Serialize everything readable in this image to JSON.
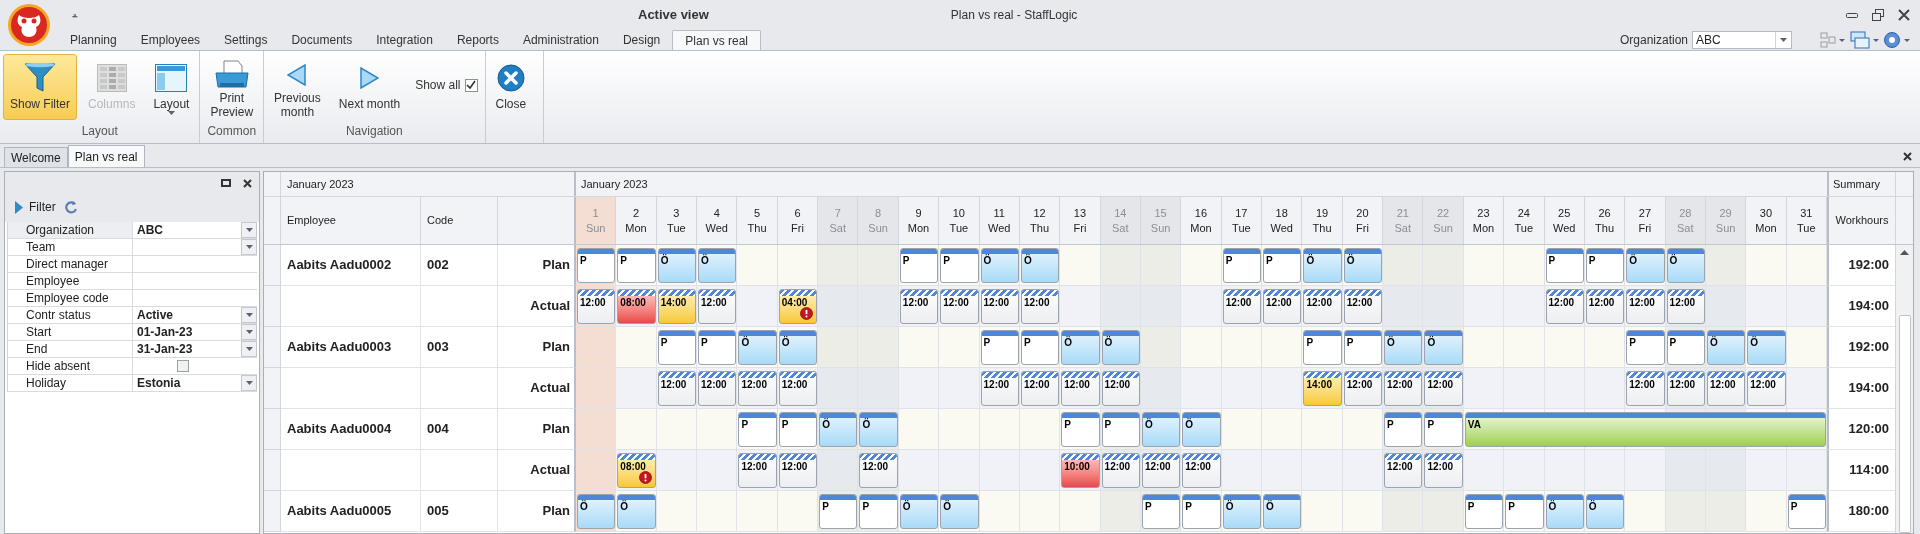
{
  "app": {
    "title": "Active view",
    "window_title": "Plan vs real - StaffLogic",
    "quick_access": "⩡"
  },
  "menu_tabs": [
    {
      "label": "Planning",
      "selected": false
    },
    {
      "label": "Employees",
      "selected": false
    },
    {
      "label": "Settings",
      "selected": false
    },
    {
      "label": "Documents",
      "selected": false
    },
    {
      "label": "Integration",
      "selected": false
    },
    {
      "label": "Reports",
      "selected": false
    },
    {
      "label": "Administration",
      "selected": false
    },
    {
      "label": "Design",
      "selected": false
    },
    {
      "label": "Plan vs real",
      "selected": true
    }
  ],
  "organization": {
    "label": "Organization",
    "value": "ABC"
  },
  "ribbon": [
    {
      "label": "Layout",
      "items": [
        {
          "kind": "filter",
          "label": "Show Filter",
          "pressed": true,
          "disabled": false
        },
        {
          "kind": "columns",
          "label": "Columns",
          "pressed": false,
          "disabled": true
        },
        {
          "kind": "layout",
          "label": "Layout",
          "pressed": false,
          "disabled": false
        }
      ]
    },
    {
      "label": "Common",
      "items": [
        {
          "kind": "print",
          "label": "Print Preview",
          "pressed": false,
          "disabled": false
        }
      ]
    },
    {
      "label": "Navigation",
      "items": [
        {
          "kind": "previous",
          "label": "Previous month",
          "pressed": false,
          "disabled": false
        },
        {
          "kind": "next",
          "label": "Next month",
          "pressed": false,
          "disabled": false
        },
        {
          "kind": "checkbox",
          "label": "Show all",
          "checked": true
        }
      ]
    },
    {
      "items": [
        {
          "kind": "close",
          "label": "Close",
          "pressed": false,
          "disabled": false
        }
      ]
    }
  ],
  "doc_tabs": [
    {
      "label": "Welcome",
      "selected": false
    },
    {
      "label": "Plan vs real",
      "selected": true
    }
  ],
  "filter_panel": {
    "title": "Filter",
    "rows": [
      {
        "label": "Organization",
        "kind": "combo",
        "value": "ABC",
        "selected": true
      },
      {
        "label": "Team",
        "kind": "combo",
        "selected": false
      },
      {
        "label": "Direct manager",
        "kind": "text",
        "selected": false
      },
      {
        "label": "Employee",
        "kind": "text",
        "selected": false
      },
      {
        "label": "Employee code",
        "kind": "text",
        "selected": false
      },
      {
        "label": "Contr status",
        "kind": "combo",
        "value": "Active",
        "selected": false
      },
      {
        "label": "Start",
        "kind": "combo",
        "value": "01-Jan-23",
        "selected": false
      },
      {
        "label": "End",
        "kind": "combo",
        "value": "31-Jan-23",
        "selected": false
      },
      {
        "label": "Hide absent",
        "kind": "checkbox",
        "checked": false,
        "selected": false
      },
      {
        "label": "Holiday",
        "kind": "combo",
        "value": "Estonia",
        "selected": false
      }
    ]
  },
  "grid": {
    "period_left": "January 2023",
    "period_days": "January 2023",
    "summary_title": "Summary",
    "columns": [
      "Employee",
      "Code"
    ],
    "summary_column": "Workhours",
    "days": [
      {
        "day": "1",
        "name": "Sun",
        "kind": "holiday"
      },
      {
        "day": "2",
        "name": "Mon",
        "kind": "workday"
      },
      {
        "day": "3",
        "name": "Tue",
        "kind": "workday"
      },
      {
        "day": "4",
        "name": "Wed",
        "kind": "workday"
      },
      {
        "day": "5",
        "name": "Thu",
        "kind": "workday"
      },
      {
        "day": "6",
        "name": "Fri",
        "kind": "workday"
      },
      {
        "day": "7",
        "name": "Sat",
        "kind": "weekend"
      },
      {
        "day": "8",
        "name": "Sun",
        "kind": "weekend"
      },
      {
        "day": "9",
        "name": "Mon",
        "kind": "workday"
      },
      {
        "day": "10",
        "name": "Tue",
        "kind": "workday"
      },
      {
        "day": "11",
        "name": "Wed",
        "kind": "workday"
      },
      {
        "day": "12",
        "name": "Thu",
        "kind": "workday"
      },
      {
        "day": "13",
        "name": "Fri",
        "kind": "workday"
      },
      {
        "day": "14",
        "name": "Sat",
        "kind": "weekend"
      },
      {
        "day": "15",
        "name": "Sun",
        "kind": "weekend"
      },
      {
        "day": "16",
        "name": "Mon",
        "kind": "workday"
      },
      {
        "day": "17",
        "name": "Tue",
        "kind": "workday"
      },
      {
        "day": "18",
        "name": "Wed",
        "kind": "workday"
      },
      {
        "day": "19",
        "name": "Thu",
        "kind": "workday"
      },
      {
        "day": "20",
        "name": "Fri",
        "kind": "workday"
      },
      {
        "day": "21",
        "name": "Sat",
        "kind": "weekend"
      },
      {
        "day": "22",
        "name": "Sun",
        "kind": "weekend"
      },
      {
        "day": "23",
        "name": "Mon",
        "kind": "workday"
      },
      {
        "day": "24",
        "name": "Tue",
        "kind": "workday"
      },
      {
        "day": "25",
        "name": "Wed",
        "kind": "workday"
      },
      {
        "day": "26",
        "name": "Thu",
        "kind": "workday"
      },
      {
        "day": "27",
        "name": "Fri",
        "kind": "workday"
      },
      {
        "day": "28",
        "name": "Sat",
        "kind": "weekend"
      },
      {
        "day": "29",
        "name": "Sun",
        "kind": "weekend"
      },
      {
        "day": "30",
        "name": "Mon",
        "kind": "workday"
      },
      {
        "day": "31",
        "name": "Tue",
        "kind": "workday"
      }
    ],
    "employees": [
      {
        "name": "Aabits Aadu0002",
        "code": "002",
        "lines": [
          {
            "type": "Plan",
            "kind": "plan",
            "total": "192:00",
            "cells": [
              {
                "kind": "work",
                "text": "P"
              },
              {
                "kind": "work",
                "text": "P"
              },
              {
                "kind": "rest",
                "text": "Ö"
              },
              {
                "kind": "rest",
                "text": "Ö"
              },
              {
                "kind": "empty"
              },
              {
                "kind": "empty"
              },
              {
                "kind": "empty"
              },
              {
                "kind": "empty"
              },
              {
                "kind": "work",
                "text": "P"
              },
              {
                "kind": "work",
                "text": "P"
              },
              {
                "kind": "rest",
                "text": "Ö"
              },
              {
                "kind": "rest",
                "text": "Ö"
              },
              {
                "kind": "empty"
              },
              {
                "kind": "empty"
              },
              {
                "kind": "empty"
              },
              {
                "kind": "empty"
              },
              {
                "kind": "work",
                "text": "P"
              },
              {
                "kind": "work",
                "text": "P"
              },
              {
                "kind": "rest",
                "text": "Ö"
              },
              {
                "kind": "rest",
                "text": "Ö"
              },
              {
                "kind": "empty"
              },
              {
                "kind": "empty"
              },
              {
                "kind": "empty"
              },
              {
                "kind": "empty"
              },
              {
                "kind": "work",
                "text": "P"
              },
              {
                "kind": "work",
                "text": "P"
              },
              {
                "kind": "rest",
                "text": "Ö"
              },
              {
                "kind": "rest",
                "text": "Ö"
              },
              {
                "kind": "empty"
              },
              {
                "kind": "empty"
              },
              {
                "kind": "empty"
              }
            ]
          },
          {
            "type": "Actual",
            "kind": "actual",
            "total": "194:00",
            "cells": [
              {
                "kind": "actual",
                "text": "12:00"
              },
              {
                "kind": "short",
                "text": "08:00"
              },
              {
                "kind": "long",
                "text": "14:00"
              },
              {
                "kind": "actual",
                "text": "12:00"
              },
              {
                "kind": "empty"
              },
              {
                "kind": "flagged",
                "text": "04:00"
              },
              {
                "kind": "empty"
              },
              {
                "kind": "empty"
              },
              {
                "kind": "actual",
                "text": "12:00"
              },
              {
                "kind": "actual",
                "text": "12:00"
              },
              {
                "kind": "actual",
                "text": "12:00"
              },
              {
                "kind": "actual",
                "text": "12:00"
              },
              {
                "kind": "empty"
              },
              {
                "kind": "empty"
              },
              {
                "kind": "empty"
              },
              {
                "kind": "empty"
              },
              {
                "kind": "actual",
                "text": "12:00"
              },
              {
                "kind": "actual",
                "text": "12:00"
              },
              {
                "kind": "actual",
                "text": "12:00"
              },
              {
                "kind": "actual",
                "text": "12:00"
              },
              {
                "kind": "empty"
              },
              {
                "kind": "empty"
              },
              {
                "kind": "empty"
              },
              {
                "kind": "empty"
              },
              {
                "kind": "actual",
                "text": "12:00"
              },
              {
                "kind": "actual",
                "text": "12:00"
              },
              {
                "kind": "actual",
                "text": "12:00"
              },
              {
                "kind": "actual",
                "text": "12:00"
              },
              {
                "kind": "empty"
              },
              {
                "kind": "empty"
              },
              {
                "kind": "empty"
              }
            ]
          }
        ]
      },
      {
        "name": "Aabits Aadu0003",
        "code": "003",
        "lines": [
          {
            "type": "Plan",
            "kind": "plan",
            "total": "192:00",
            "cells": [
              {
                "kind": "empty"
              },
              {
                "kind": "empty"
              },
              {
                "kind": "work",
                "text": "P"
              },
              {
                "kind": "work",
                "text": "P"
              },
              {
                "kind": "rest",
                "text": "Ö"
              },
              {
                "kind": "rest",
                "text": "Ö"
              },
              {
                "kind": "empty"
              },
              {
                "kind": "empty"
              },
              {
                "kind": "empty"
              },
              {
                "kind": "empty"
              },
              {
                "kind": "work",
                "text": "P"
              },
              {
                "kind": "work",
                "text": "P"
              },
              {
                "kind": "rest",
                "text": "Ö"
              },
              {
                "kind": "rest",
                "text": "Ö"
              },
              {
                "kind": "empty"
              },
              {
                "kind": "empty"
              },
              {
                "kind": "empty"
              },
              {
                "kind": "empty"
              },
              {
                "kind": "work",
                "text": "P"
              },
              {
                "kind": "work",
                "text": "P"
              },
              {
                "kind": "rest",
                "text": "Ö"
              },
              {
                "kind": "rest",
                "text": "Ö"
              },
              {
                "kind": "empty"
              },
              {
                "kind": "empty"
              },
              {
                "kind": "empty"
              },
              {
                "kind": "empty"
              },
              {
                "kind": "work",
                "text": "P"
              },
              {
                "kind": "work",
                "text": "P"
              },
              {
                "kind": "rest",
                "text": "Ö"
              },
              {
                "kind": "rest",
                "text": "Ö"
              },
              {
                "kind": "empty"
              }
            ]
          },
          {
            "type": "Actual",
            "kind": "actual",
            "total": "194:00",
            "cells": [
              {
                "kind": "empty"
              },
              {
                "kind": "empty"
              },
              {
                "kind": "actual",
                "text": "12:00"
              },
              {
                "kind": "actual",
                "text": "12:00"
              },
              {
                "kind": "actual",
                "text": "12:00"
              },
              {
                "kind": "actual",
                "text": "12:00"
              },
              {
                "kind": "empty"
              },
              {
                "kind": "empty"
              },
              {
                "kind": "empty"
              },
              {
                "kind": "empty"
              },
              {
                "kind": "actual",
                "text": "12:00"
              },
              {
                "kind": "actual",
                "text": "12:00"
              },
              {
                "kind": "actual",
                "text": "12:00"
              },
              {
                "kind": "actual",
                "text": "12:00"
              },
              {
                "kind": "empty"
              },
              {
                "kind": "empty"
              },
              {
                "kind": "empty"
              },
              {
                "kind": "empty"
              },
              {
                "kind": "long",
                "text": "14:00"
              },
              {
                "kind": "actual",
                "text": "12:00"
              },
              {
                "kind": "actual",
                "text": "12:00"
              },
              {
                "kind": "actual",
                "text": "12:00"
              },
              {
                "kind": "empty"
              },
              {
                "kind": "empty"
              },
              {
                "kind": "empty"
              },
              {
                "kind": "empty"
              },
              {
                "kind": "actual",
                "text": "12:00"
              },
              {
                "kind": "actual",
                "text": "12:00"
              },
              {
                "kind": "actual",
                "text": "12:00"
              },
              {
                "kind": "actual",
                "text": "12:00"
              },
              {
                "kind": "empty"
              }
            ]
          }
        ]
      },
      {
        "name": "Aabits Aadu0004",
        "code": "004",
        "lines": [
          {
            "type": "Plan",
            "kind": "plan",
            "total": "120:00",
            "cells": [
              {
                "kind": "empty"
              },
              {
                "kind": "empty"
              },
              {
                "kind": "empty"
              },
              {
                "kind": "empty"
              },
              {
                "kind": "work",
                "text": "P"
              },
              {
                "kind": "work",
                "text": "P"
              },
              {
                "kind": "rest",
                "text": "Ö"
              },
              {
                "kind": "rest",
                "text": "Ö"
              },
              {
                "kind": "empty"
              },
              {
                "kind": "empty"
              },
              {
                "kind": "empty"
              },
              {
                "kind": "empty"
              },
              {
                "kind": "work",
                "text": "P"
              },
              {
                "kind": "work",
                "text": "P"
              },
              {
                "kind": "rest",
                "text": "Ö"
              },
              {
                "kind": "rest",
                "text": "Ö"
              },
              {
                "kind": "empty"
              },
              {
                "kind": "empty"
              },
              {
                "kind": "empty"
              },
              {
                "kind": "empty"
              },
              {
                "kind": "work",
                "text": "P"
              },
              {
                "kind": "work",
                "text": "P"
              },
              {
                "kind": "leave",
                "text": "VA"
              },
              {
                "kind": "cont"
              },
              {
                "kind": "cont"
              },
              {
                "kind": "cont"
              },
              {
                "kind": "cont"
              },
              {
                "kind": "cont"
              },
              {
                "kind": "cont"
              },
              {
                "kind": "cont"
              },
              {
                "kind": "cont"
              }
            ]
          },
          {
            "type": "Actual",
            "kind": "actual",
            "total": "114:00",
            "cells": [
              {
                "kind": "empty"
              },
              {
                "kind": "flagged",
                "text": "08:00"
              },
              {
                "kind": "empty"
              },
              {
                "kind": "empty"
              },
              {
                "kind": "actual",
                "text": "12:00"
              },
              {
                "kind": "actual",
                "text": "12:00"
              },
              {
                "kind": "empty"
              },
              {
                "kind": "actual",
                "text": "12:00"
              },
              {
                "kind": "empty"
              },
              {
                "kind": "empty"
              },
              {
                "kind": "empty"
              },
              {
                "kind": "empty"
              },
              {
                "kind": "short",
                "text": "10:00"
              },
              {
                "kind": "actual",
                "text": "12:00"
              },
              {
                "kind": "actual",
                "text": "12:00"
              },
              {
                "kind": "actual",
                "text": "12:00"
              },
              {
                "kind": "empty"
              },
              {
                "kind": "empty"
              },
              {
                "kind": "empty"
              },
              {
                "kind": "empty"
              },
              {
                "kind": "actual",
                "text": "12:00"
              },
              {
                "kind": "actual",
                "text": "12:00"
              },
              {
                "kind": "empty"
              },
              {
                "kind": "empty"
              },
              {
                "kind": "empty"
              },
              {
                "kind": "empty"
              },
              {
                "kind": "empty"
              },
              {
                "kind": "empty"
              },
              {
                "kind": "empty"
              },
              {
                "kind": "empty"
              },
              {
                "kind": "empty"
              }
            ]
          }
        ]
      },
      {
        "name": "Aabits Aadu0005",
        "code": "005",
        "lines": [
          {
            "type": "Plan",
            "kind": "plan",
            "total": "180:00",
            "cells": [
              {
                "kind": "rest",
                "text": "Ö"
              },
              {
                "kind": "rest",
                "text": "Ö"
              },
              {
                "kind": "empty"
              },
              {
                "kind": "empty"
              },
              {
                "kind": "empty"
              },
              {
                "kind": "empty"
              },
              {
                "kind": "work",
                "text": "P"
              },
              {
                "kind": "work",
                "text": "P"
              },
              {
                "kind": "rest",
                "text": "Ö"
              },
              {
                "kind": "rest",
                "text": "Ö"
              },
              {
                "kind": "empty"
              },
              {
                "kind": "empty"
              },
              {
                "kind": "empty"
              },
              {
                "kind": "empty"
              },
              {
                "kind": "work",
                "text": "P"
              },
              {
                "kind": "work",
                "text": "P"
              },
              {
                "kind": "rest",
                "text": "Ö"
              },
              {
                "kind": "rest",
                "text": "Ö"
              },
              {
                "kind": "empty"
              },
              {
                "kind": "empty"
              },
              {
                "kind": "empty"
              },
              {
                "kind": "empty"
              },
              {
                "kind": "work",
                "text": "P"
              },
              {
                "kind": "work",
                "text": "P"
              },
              {
                "kind": "rest",
                "text": "Ö"
              },
              {
                "kind": "rest",
                "text": "Ö"
              },
              {
                "kind": "empty"
              },
              {
                "kind": "empty"
              },
              {
                "kind": "empty"
              },
              {
                "kind": "empty"
              },
              {
                "kind": "work",
                "text": "P"
              }
            ]
          }
        ]
      }
    ]
  }
}
